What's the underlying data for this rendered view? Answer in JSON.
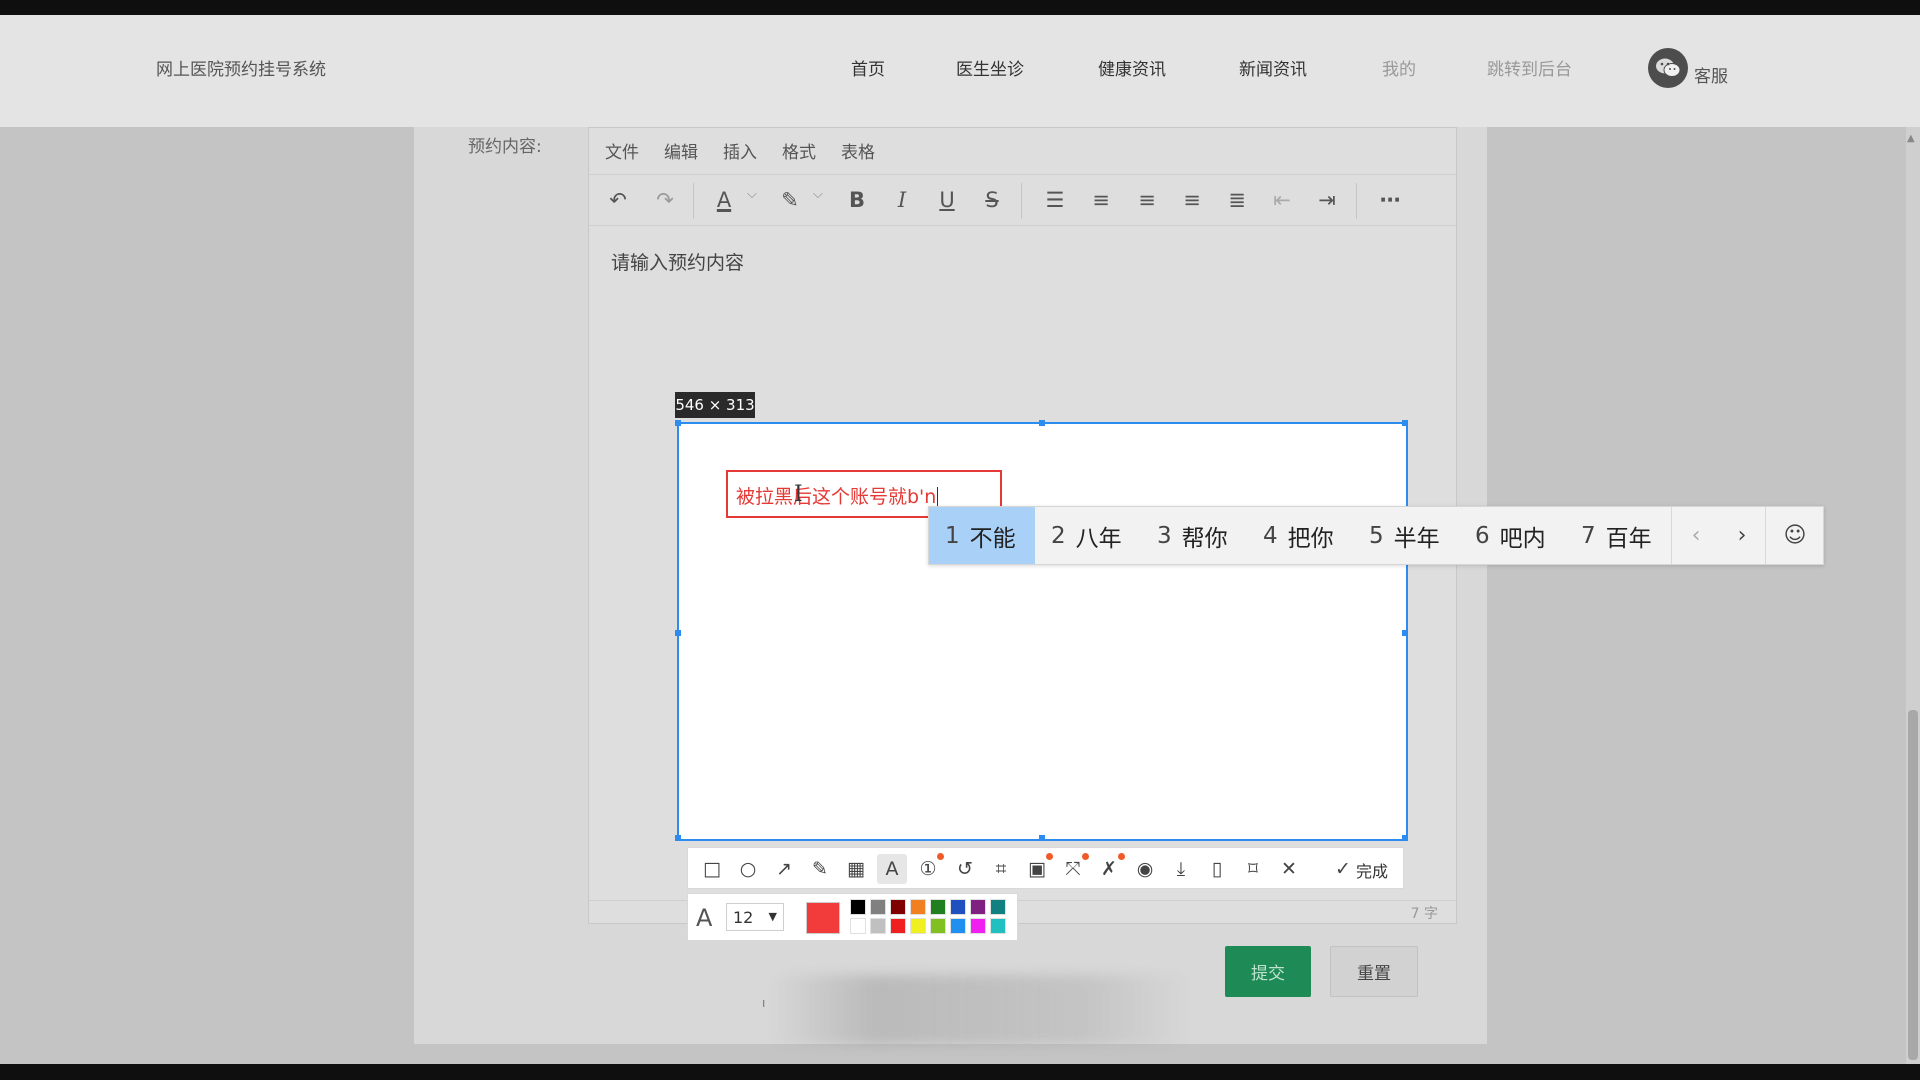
{
  "site": {
    "title": "网上医院预约挂号系统"
  },
  "nav": {
    "items": [
      {
        "label": "首页"
      },
      {
        "label": "医生坐诊"
      },
      {
        "label": "健康资讯"
      },
      {
        "label": "新闻资讯"
      },
      {
        "label": "我的"
      },
      {
        "label": "跳转到后台"
      }
    ],
    "service_label": "客服"
  },
  "form": {
    "field_label": "预约内容:",
    "submit_label": "提交",
    "reset_label": "重置"
  },
  "editor": {
    "menus": [
      "文件",
      "编辑",
      "插入",
      "格式",
      "表格"
    ],
    "placeholder": "请输入预约内容",
    "word_count": "7 字",
    "toolbar_icons": [
      "undo-icon",
      "redo-icon",
      "font-color-icon",
      "highlight-icon",
      "bold-icon",
      "italic-icon",
      "underline-icon",
      "strikethrough-icon",
      "line-height-icon",
      "align-left-icon",
      "align-center-icon",
      "align-right-icon",
      "align-justify-icon",
      "outdent-icon",
      "indent-icon",
      "more-icon"
    ]
  },
  "screenshot_tool": {
    "size_label": "546 × 313",
    "annotation_text": "被拉黑后这个账号就b'n",
    "done_label": "完成",
    "font_size": "12",
    "current_color": "#f23c3c",
    "palette_top": [
      "#000000",
      "#808080",
      "#800000",
      "#f08020",
      "#208020",
      "#2050c0",
      "#802080",
      "#108080"
    ],
    "palette_bottom": [
      "#ffffff",
      "#c0c0c0",
      "#f02020",
      "#f0f020",
      "#80c020",
      "#2090f0",
      "#f020f0",
      "#20c0c0"
    ],
    "tools": [
      "rectangle-icon",
      "ellipse-icon",
      "arrow-icon",
      "pencil-icon",
      "mosaic-icon",
      "text-icon",
      "numbered-marker-icon",
      "undo-icon",
      "crop-icon",
      "ocr-icon",
      "scroll-capture-icon",
      "pin-icon",
      "record-icon",
      "download-icon",
      "save-icon",
      "bookmark-icon",
      "close-icon",
      "check-icon"
    ]
  },
  "ime": {
    "candidates": [
      {
        "num": "1",
        "text": "不能"
      },
      {
        "num": "2",
        "text": "八年"
      },
      {
        "num": "3",
        "text": "帮你"
      },
      {
        "num": "4",
        "text": "把你"
      },
      {
        "num": "5",
        "text": "半年"
      },
      {
        "num": "6",
        "text": "吧内"
      },
      {
        "num": "7",
        "text": "百年"
      }
    ]
  }
}
